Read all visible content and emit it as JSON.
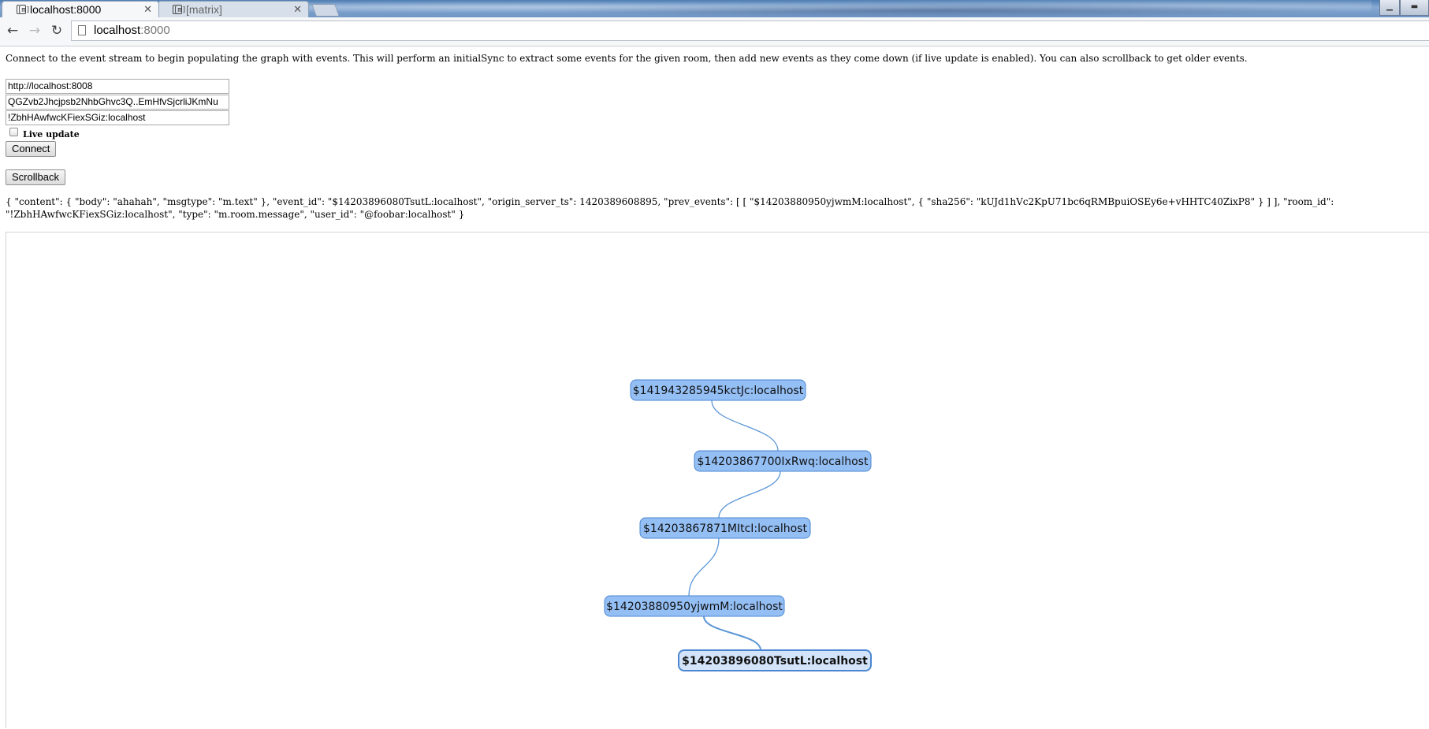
{
  "browser": {
    "tabs": [
      {
        "title": "localhost:8000",
        "active": true
      },
      {
        "title": "[matrix]",
        "active": false
      }
    ],
    "address": {
      "host": "localhost",
      "port": ":8000"
    }
  },
  "page": {
    "intro": "Connect to the event stream to begin populating the graph with events. This will perform an initialSync to extract some events for the given room, then add new events as they come down (if live update is enabled). You can also scrollback to get older events.",
    "server_url": "http://localhost:8008",
    "access_token": "QGZvb2Jhcjpsb2NhbGhvc3Q..EmHfvSjcrliJKmNu",
    "room_id": "!ZbhHAwfwcKFiexSGiz:localhost",
    "live_update_label": "Live update",
    "live_update_checked": false,
    "connect_label": "Connect",
    "scrollback_label": "Scrollback",
    "event_json": "{ \"content\": { \"body\": \"ahahah\", \"msgtype\": \"m.text\" }, \"event_id\": \"$14203896080TsutL:localhost\", \"origin_server_ts\": 1420389608895, \"prev_events\": [ [ \"$14203880950yjwmM:localhost\", { \"sha256\": \"kUJd1hVc2KpU71bc6qRMBpuiOSEy6e+vHHTC40ZixP8\" } ] ], \"room_id\": \"!ZbhHAwfwcKFiexSGiz:localhost\", \"type\": \"m.room.message\", \"user_id\": \"@foobar:localhost\" }"
  },
  "graph": {
    "node_fill": "#94bff5",
    "node_stroke": "#4a86d0",
    "selected_fill": "#d3e4fa",
    "edge_color": "#5a96d6",
    "nodes": [
      {
        "id": "$141943285945kctJc:localhost",
        "selected": false
      },
      {
        "id": "$14203867700IxRwq:localhost",
        "selected": false
      },
      {
        "id": "$14203867871MItcI:localhost",
        "selected": false
      },
      {
        "id": "$14203880950yjwmM:localhost",
        "selected": false
      },
      {
        "id": "$14203896080TsutL:localhost",
        "selected": true
      }
    ],
    "edges": [
      {
        "from": "$141943285945kctJc:localhost",
        "to": "$14203867700IxRwq:localhost"
      },
      {
        "from": "$14203867700IxRwq:localhost",
        "to": "$14203867871MItcI:localhost"
      },
      {
        "from": "$14203867871MItcI:localhost",
        "to": "$14203880950yjwmM:localhost"
      },
      {
        "from": "$14203880950yjwmM:localhost",
        "to": "$14203896080TsutL:localhost"
      }
    ]
  }
}
